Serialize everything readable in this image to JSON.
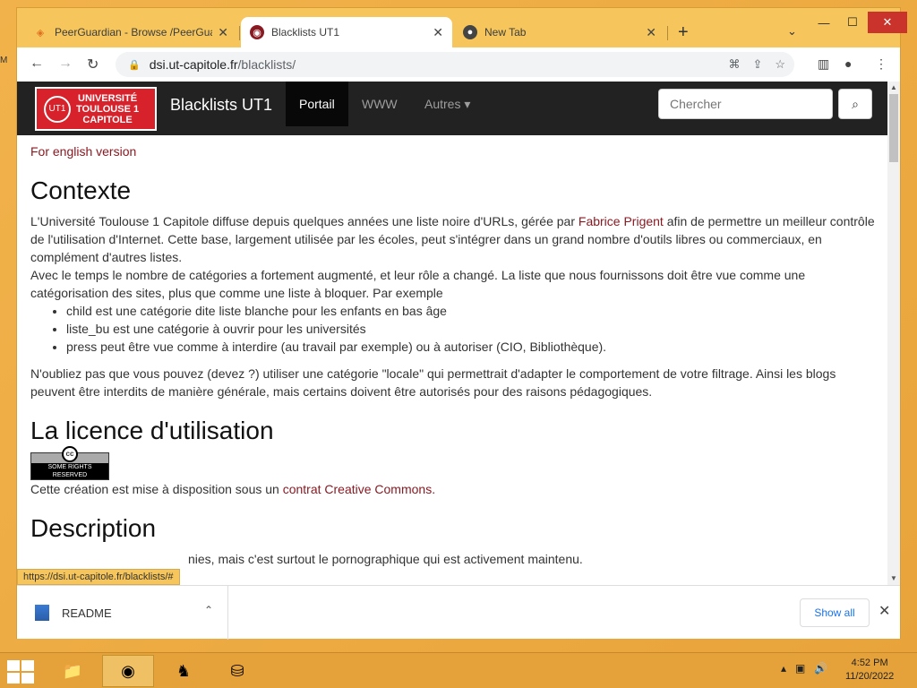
{
  "desktop": {
    "edge_text": "M"
  },
  "browser": {
    "tabs": [
      {
        "title": "PeerGuardian - Browse /PeerGua",
        "icon": "peerguardian-icon",
        "active": false
      },
      {
        "title": "Blacklists UT1",
        "icon": "ut1-icon",
        "active": true
      },
      {
        "title": "New Tab",
        "icon": "chrome-icon",
        "active": false
      }
    ],
    "new_tab_label": "+",
    "address": {
      "host": "dsi.ut-capitole.fr",
      "path": "/blacklists/"
    },
    "status_url": "https://dsi.ut-capitole.fr/blacklists/#"
  },
  "site": {
    "logo_lines": [
      "UNIVERSITÉ",
      "TOULOUSE 1",
      "CAPITOLE"
    ],
    "brand": "Blacklists UT1",
    "nav": [
      {
        "label": "Portail",
        "active": true
      },
      {
        "label": "WWW",
        "active": false
      },
      {
        "label": "Autres ▾",
        "active": false
      }
    ],
    "search_placeholder": "Chercher",
    "english_link": "For english version",
    "h_context": "Contexte",
    "p1_a": "L'Université Toulouse 1 Capitole diffuse depuis quelques années une liste noire d'URLs, gérée par ",
    "p1_link": "Fabrice Prigent",
    "p1_b": " afin de permettre un meilleur contrôle de l'utilisation d'Internet. Cette base, largement utilisée par les écoles, peut s'intégrer dans un grand nombre d'outils libres ou commerciaux, en complément d'autres listes.",
    "p2": "Avec le temps le nombre de catégories a fortement augmenté, et leur rôle a changé. La liste que nous fournissons doit être vue comme une catégorisation des sites, plus que comme une liste à bloquer. Par exemple",
    "bullets": [
      "child est une catégorie dite liste blanche pour les enfants en bas âge",
      "liste_bu est une catégorie à ouvrir pour les universités",
      "press peut être vue comme à interdire (au travail par exemple) ou à autoriser (CIO, Bibliothèque)."
    ],
    "p3": "N'oubliez pas que vous pouvez (devez ?) utiliser une catégorie \"locale\" qui permettrait d'adapter le comportement de votre filtrage. Ainsi les blogs peuvent être interdits de manière générale, mais certains doivent être autorisés pour des raisons pédagogiques.",
    "h_license": "La licence d'utilisation",
    "cc_badge_text": "SOME RIGHTS RESERVED",
    "license_text": "Cette création est mise à disposition sous un ",
    "license_link": "contrat Creative Commons.",
    "h_description": "Description",
    "desc_partial": "nies, mais c'est surtout le pornographique qui est activement maintenu."
  },
  "downloads": {
    "file_name": "README",
    "show_all_label": "Show all"
  },
  "taskbar": {
    "time": "4:52 PM",
    "date": "11/20/2022"
  },
  "colors": {
    "accent_window": "#f6c65c",
    "navbar": "#222222",
    "link": "#8a1a22",
    "logo_red": "#d8222b"
  }
}
